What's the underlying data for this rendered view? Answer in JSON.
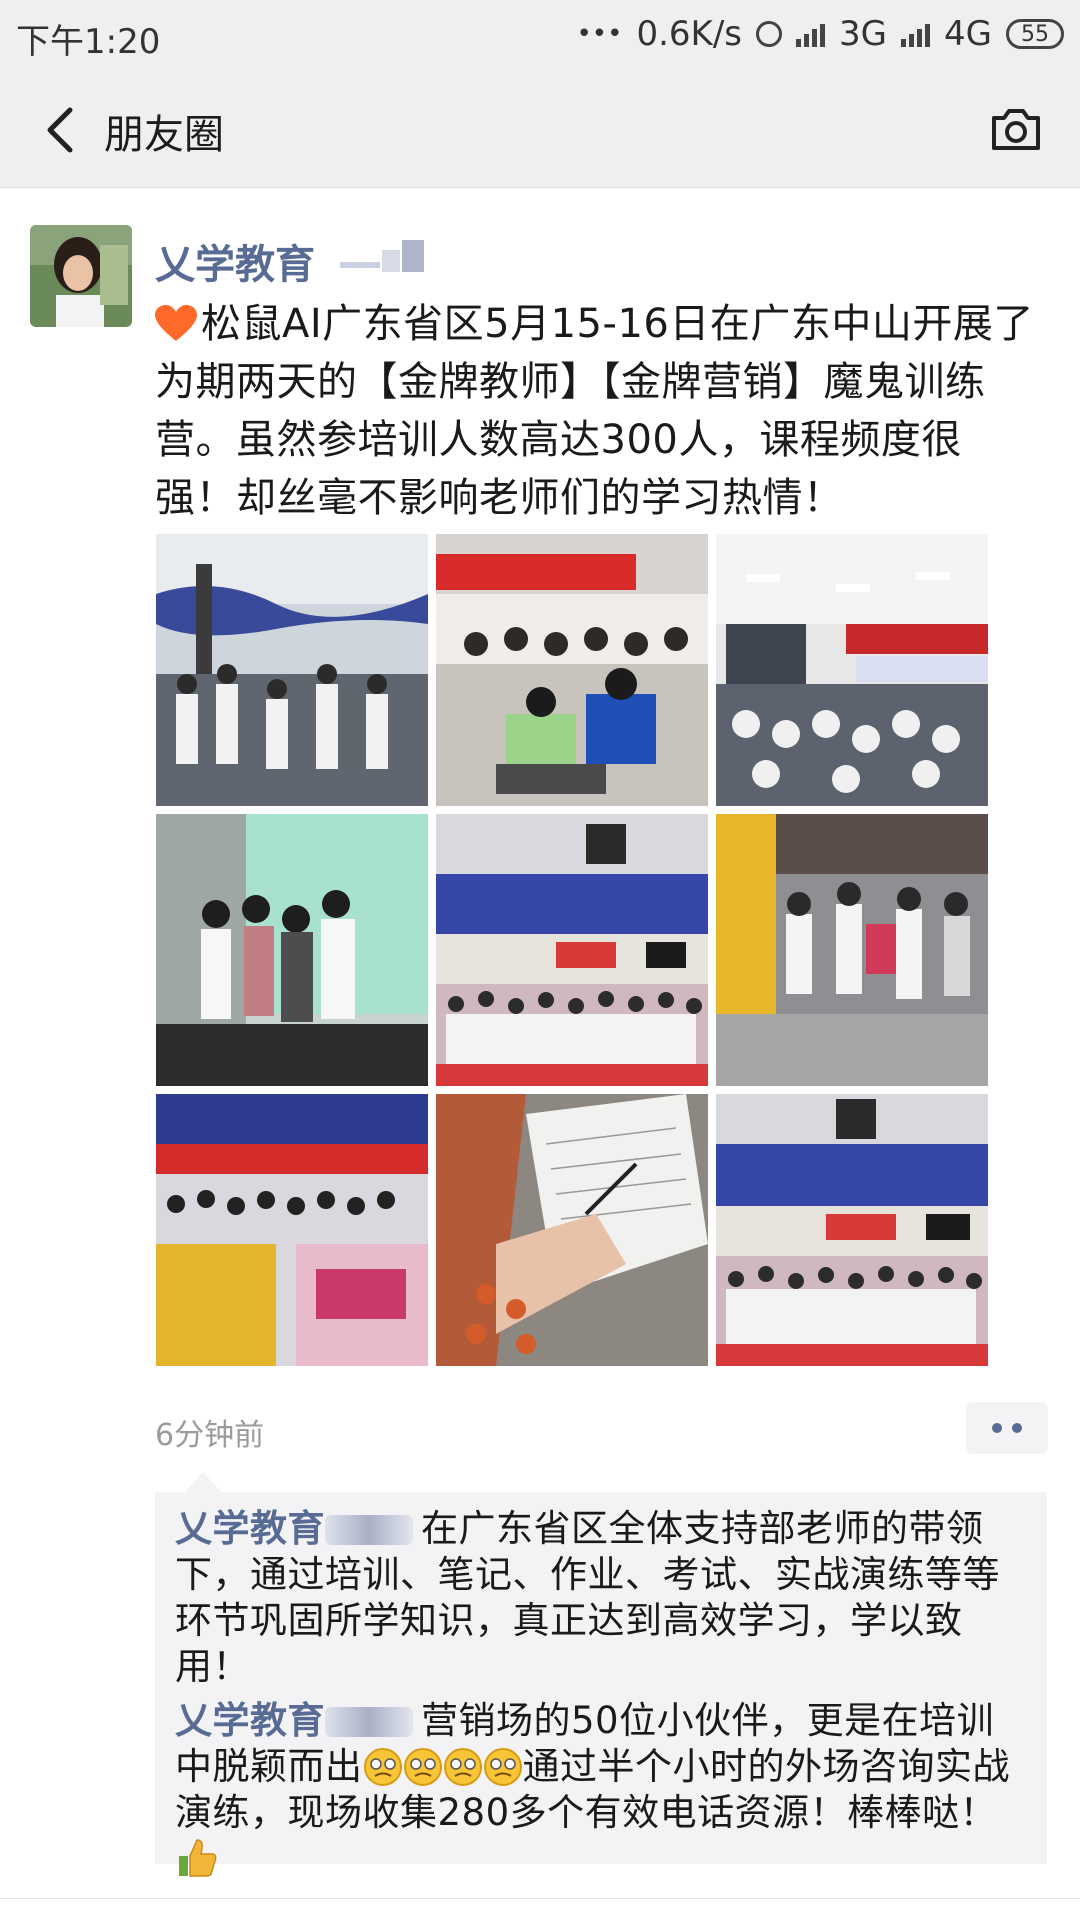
{
  "status_bar": {
    "time": "下午1:20",
    "dots": "•••",
    "speed": "0.6K/s",
    "net_3g": "3G",
    "net_4g": "4G",
    "battery": "55"
  },
  "nav": {
    "title": "朋友圈"
  },
  "moment": {
    "author": "乂学教育",
    "text": "松鼠AI广东省区5月15-16日在广东中山开展了为期两天的【金牌教师】【金牌营销】魔鬼训练营。虽然参培训人数高达300人，课程频度很强！却丝毫不影响老师们的学习热情！",
    "time": "6分钟前",
    "photos": [
      {
        "icon": "training-hall-photo"
      },
      {
        "icon": "classroom-students-photo"
      },
      {
        "icon": "lecture-hall-photo"
      },
      {
        "icon": "group-practice-photo"
      },
      {
        "icon": "storefront-group-photo"
      },
      {
        "icon": "mall-street-photo"
      },
      {
        "icon": "audience-banner-photo"
      },
      {
        "icon": "note-taking-photo"
      },
      {
        "icon": "storefront-group-photo-2"
      }
    ]
  },
  "comments": [
    {
      "author": "乂学教育",
      "text": "在广东省区全体支持部老师的带领下，通过培训、笔记、作业、考试、实战演练等等环节巩固所学知识，真正达到高效学习，学以致用！"
    },
    {
      "author": "乂学教育",
      "text_before": "营销场的50位小伙伴，更是在培训中脱颖而出",
      "text_after": "通过半个小时的外场咨询实战演练，现场收集280多个有效电话资源！棒棒哒！"
    }
  ],
  "colors": {
    "link_blue": "#576b95",
    "nav_bg": "#efefef",
    "comment_bg": "#f3f3f5"
  }
}
